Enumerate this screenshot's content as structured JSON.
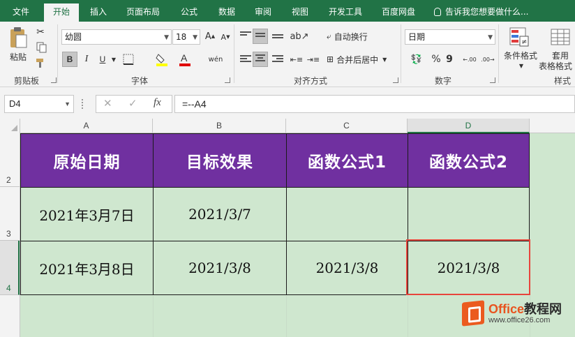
{
  "tabs": [
    {
      "label": "文件",
      "active": false
    },
    {
      "label": "开始",
      "active": true
    },
    {
      "label": "插入",
      "active": false
    },
    {
      "label": "页面布局",
      "active": false
    },
    {
      "label": "公式",
      "active": false
    },
    {
      "label": "数据",
      "active": false
    },
    {
      "label": "审阅",
      "active": false
    },
    {
      "label": "视图",
      "active": false
    },
    {
      "label": "开发工具",
      "active": false
    },
    {
      "label": "百度网盘",
      "active": false
    }
  ],
  "tell_me": "告诉我您想要做什么...",
  "ribbon": {
    "clipboard": {
      "paste_label": "粘贴",
      "group_label": "剪贴板"
    },
    "font": {
      "font_name": "幼圆",
      "font_size": "18",
      "bold": "B",
      "italic": "I",
      "underline": "U",
      "phonetic": "wén",
      "group_label": "字体"
    },
    "alignment": {
      "wrap_text": "自动换行",
      "merge_center": "合并后居中",
      "group_label": "对齐方式"
    },
    "number": {
      "format": "日期",
      "percent": "%",
      "comma": "9",
      "group_label": "数字"
    },
    "styles": {
      "conditional_format": "条件格式",
      "table_format_1": "套用",
      "table_format_2": "表格格式",
      "group_label": "样式"
    }
  },
  "formula_bar": {
    "name_box": "D4",
    "cancel": "✕",
    "enter": "✓",
    "fx": "fx",
    "formula": "=--A4"
  },
  "sheet": {
    "columns": [
      "A",
      "B",
      "C",
      "D"
    ],
    "selected_column": "D",
    "rows": [
      "2",
      "3",
      "4"
    ],
    "selected_row": "4",
    "header_cells": [
      "原始日期",
      "目标效果",
      "函数公式1",
      "函数公式2"
    ],
    "row3": [
      "2021年3月7日",
      "2021/3/7",
      "",
      ""
    ],
    "row4": [
      "2021年3月8日",
      "2021/3/8",
      "2021/3/8",
      "2021/3/8"
    ],
    "header_color": "#7030a0",
    "cell_fill": "#cfe7cf"
  },
  "watermark": {
    "brand_a": "Office",
    "brand_b": "教程网",
    "url": "www.office26.com"
  }
}
